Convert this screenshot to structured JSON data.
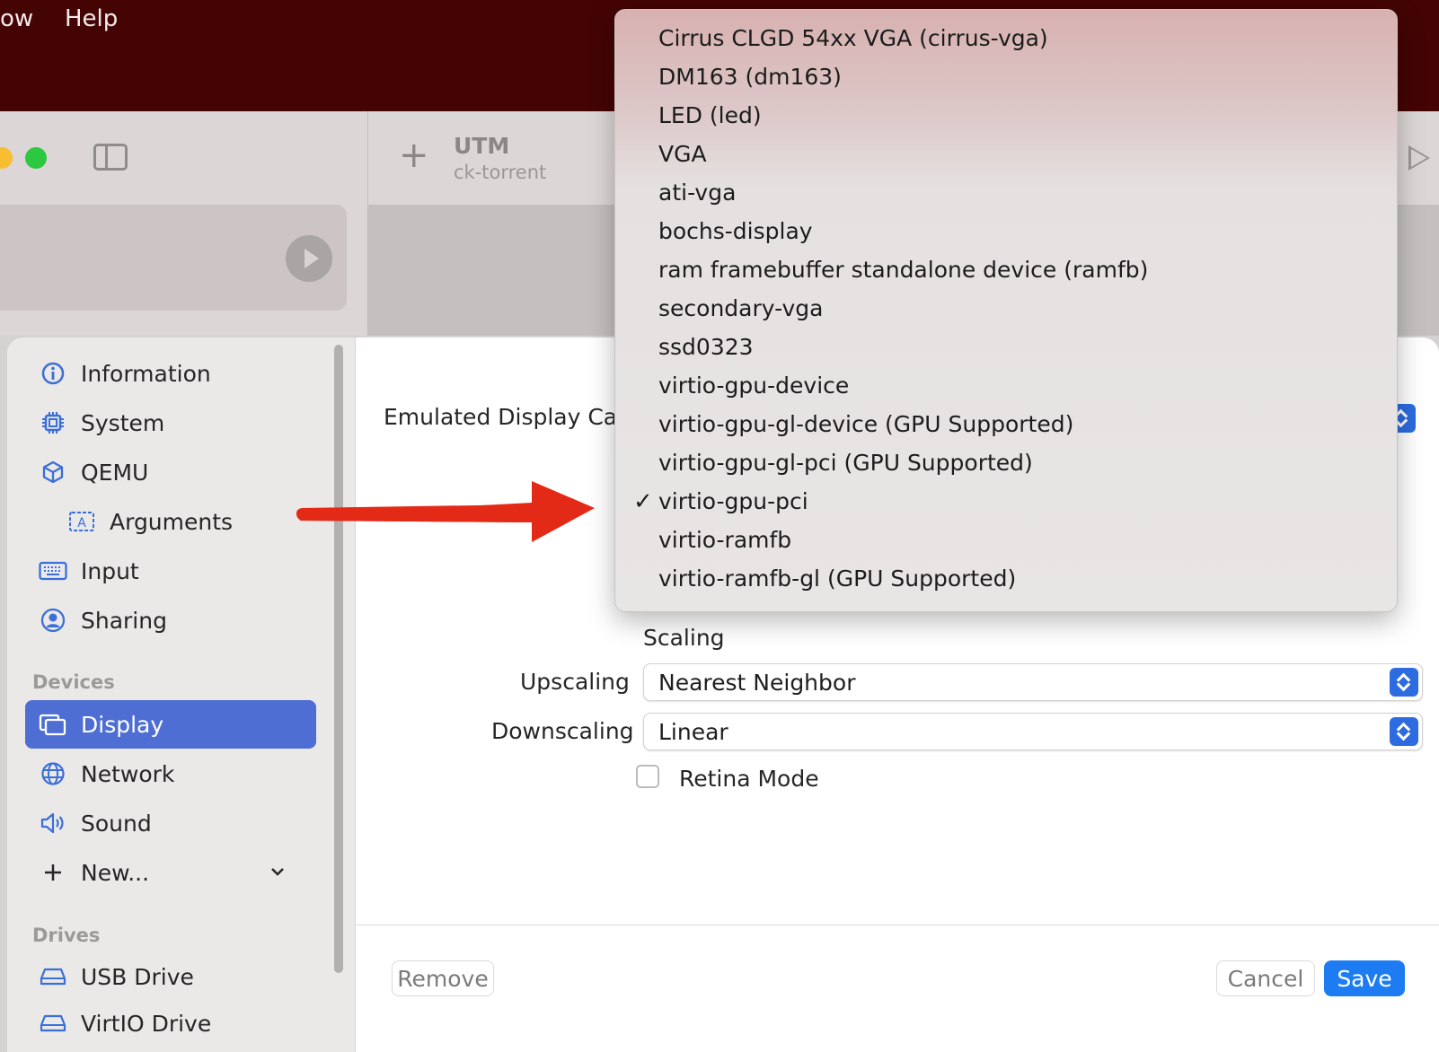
{
  "menubar": {
    "items": [
      "ow",
      "Help"
    ]
  },
  "toolbar": {
    "app_title": "UTM",
    "vm_name": "ck-torrent"
  },
  "colors": {
    "menubar_bg": "#440404",
    "accent": "#2c6be0",
    "selection": "#4e6ed4",
    "annotation_arrow": "#e22a17",
    "traffic_yellow": "#f6be30",
    "traffic_green": "#2bc840"
  },
  "sidebar": {
    "items": [
      {
        "label": "Information",
        "icon": "info-circle-icon"
      },
      {
        "label": "System",
        "icon": "cpu-chip-icon"
      },
      {
        "label": "QEMU",
        "icon": "cube-icon"
      },
      {
        "label": "Arguments",
        "icon": "text-box-icon"
      },
      {
        "label": "Input",
        "icon": "keyboard-icon"
      },
      {
        "label": "Sharing",
        "icon": "person-circle-icon"
      }
    ],
    "devices_header": "Devices",
    "devices": [
      {
        "label": "Display",
        "icon": "display-icon",
        "selected": true
      },
      {
        "label": "Network",
        "icon": "globe-icon"
      },
      {
        "label": "Sound",
        "icon": "speaker-icon"
      },
      {
        "label": "New...",
        "icon": "plus-icon"
      }
    ],
    "drives_header": "Drives",
    "drives": [
      {
        "label": "USB Drive",
        "icon": "drive-icon"
      },
      {
        "label": "VirtIO Drive",
        "icon": "drive-icon"
      }
    ]
  },
  "form": {
    "emulated_label": "Emulated Display Car",
    "scaling_label": "Scaling",
    "upscaling_label": "Upscaling",
    "upscaling_value": "Nearest Neighbor",
    "downscaling_label": "Downscaling",
    "downscaling_value": "Linear",
    "retina_label": "Retina Mode",
    "retina_checked": false
  },
  "footer": {
    "remove_label": "Remove",
    "cancel_label": "Cancel",
    "save_label": "Save"
  },
  "popup": {
    "selected": "virtio-gpu-pci",
    "check_glyph": "✓",
    "options": [
      "Cirrus CLGD 54xx VGA (cirrus-vga)",
      "DM163 (dm163)",
      "LED (led)",
      "VGA",
      "ati-vga",
      "bochs-display",
      "ram framebuffer standalone device (ramfb)",
      "secondary-vga",
      "ssd0323",
      "virtio-gpu-device",
      "virtio-gpu-gl-device (GPU Supported)",
      "virtio-gpu-gl-pci (GPU Supported)",
      "virtio-gpu-pci",
      "virtio-ramfb",
      "virtio-ramfb-gl (GPU Supported)"
    ]
  }
}
